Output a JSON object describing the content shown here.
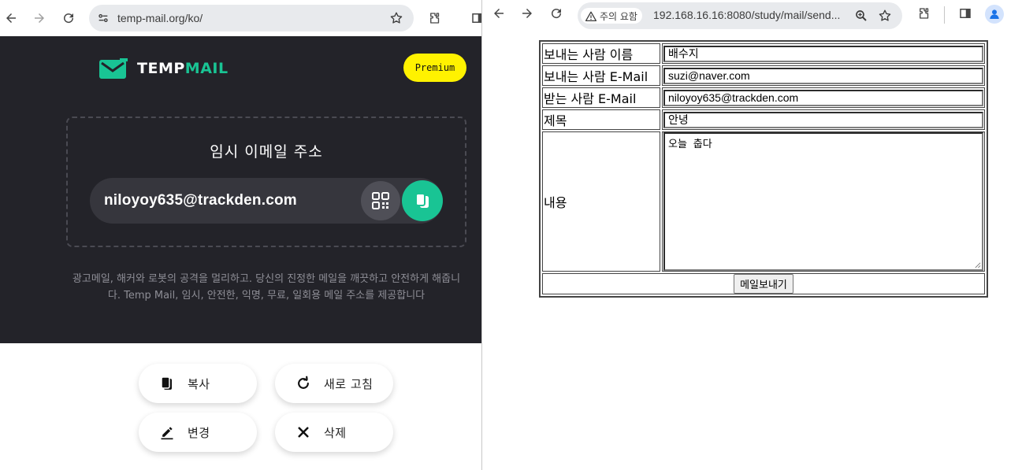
{
  "left_browser": {
    "url": "temp-mail.org/ko/"
  },
  "tempmail": {
    "logo_temp": "TEMP",
    "logo_mail": "MAIL",
    "premium_label": "Premium",
    "box_title": "임시 이메일 주소",
    "email": "niloyoy635@trackden.com",
    "description": "광고메일, 해커와 로봇의 공격을 멀리하고. 당신의 진정한 메일을 깨끗하고 안전하게 해줍니다. Temp Mail, 임시, 안전한, 익명, 무료, 일회용 메일 주소를 제공합니다",
    "actions": {
      "copy": "복사",
      "refresh": "새로 고침",
      "change": "변경",
      "delete": "삭제"
    },
    "colors": {
      "hero_bg": "#232329",
      "accent": "#19c494",
      "premium": "#fff200"
    }
  },
  "right_browser": {
    "security_chip": "주의 요함",
    "url": "192.168.16.16:8080/study/mail/send..."
  },
  "mail_form": {
    "sender_name_label": "보내는 사람 이름",
    "sender_name_value": "배수지",
    "sender_email_label": "보내는 사람 E-Mail",
    "sender_email_value": "suzi@naver.com",
    "receiver_email_label": "받는 사람 E-Mail",
    "receiver_email_value": "niloyoy635@trackden.com",
    "subject_label": "제목",
    "subject_value": "안녕",
    "content_label": "내용",
    "content_value": "오늘 춥다",
    "submit_label": "메일보내기"
  }
}
